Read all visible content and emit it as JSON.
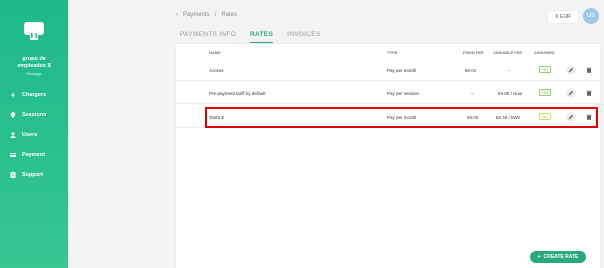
{
  "sidebar": {
    "org_name_line1": "grupo de",
    "org_name_line2": "empleados $",
    "org_sub": "Ohmyge",
    "items": [
      {
        "label": "Chargers",
        "icon": "lightning-icon"
      },
      {
        "label": "Sessions",
        "icon": "location-pin-icon"
      },
      {
        "label": "Users",
        "icon": "user-icon"
      },
      {
        "label": "Payment",
        "icon": "card-icon"
      },
      {
        "label": "Support",
        "icon": "document-icon"
      }
    ]
  },
  "header": {
    "breadcrumb_back": "‹",
    "breadcrumb_parent": "Payments",
    "breadcrumb_sep": "/",
    "breadcrumb_current": "Rates",
    "currency_symbol": "€",
    "currency_code": "EUR",
    "avatar_initials": "US"
  },
  "tabs": [
    {
      "label": "PAYMENTS INFO",
      "active": false
    },
    {
      "label": "RATES",
      "active": true
    },
    {
      "label": "INVOICES",
      "active": false
    }
  ],
  "table": {
    "columns": [
      "NAME",
      "TYPE",
      "FIXED FEE",
      "VARIABLE FEE",
      "ASSIGNED"
    ],
    "rows": [
      {
        "name": "Access",
        "type": "Pay per month",
        "fixed": "€0.01",
        "variable": "–",
        "assigned": "YES"
      },
      {
        "name": "Pre-payment tariff by default",
        "type": "Pay per session",
        "fixed": "–",
        "variable": "€4.00 / Hour",
        "assigned": "YES"
      },
      {
        "name": "Tarifa $",
        "type": "Pay per month",
        "fixed": "€5.00",
        "variable": "€0.40 / kWh",
        "assigned": "NO"
      }
    ]
  },
  "create_button": {
    "plus": "+",
    "label": "CREATE RATE"
  },
  "colors": {
    "accent": "#2aa97c",
    "highlight": "#e10000",
    "badge": "#6cc24a"
  }
}
